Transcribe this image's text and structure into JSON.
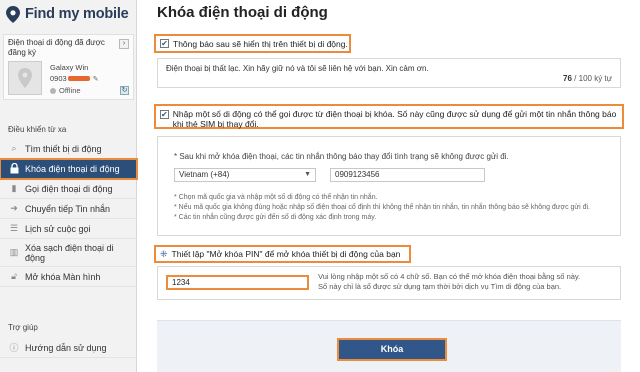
{
  "brand": {
    "name": "Find my mobile"
  },
  "device_box": {
    "title": "Điện thoại di động đã được đăng ký",
    "device_name": "Galaxy Win",
    "number_prefix": "0903",
    "status": "Offline"
  },
  "sidebar": {
    "section_remote": "Điều khiển từ xa",
    "items": [
      {
        "label": "Tìm thiết bị di động",
        "icon": "search-icon"
      },
      {
        "label": "Khóa điện thoại di động",
        "icon": "lock-icon",
        "active": true
      },
      {
        "label": "Gọi điện thoại di động",
        "icon": "phone-icon"
      },
      {
        "label": "Chuyển tiếp Tin nhắn",
        "icon": "forward-icon"
      },
      {
        "label": "Lịch sử cuộc gọi",
        "icon": "list-icon"
      },
      {
        "label": "Xóa sạch điện thoại di động",
        "icon": "trash-icon"
      },
      {
        "label": "Mở khóa Màn hình",
        "icon": "unlock-icon"
      }
    ],
    "section_help": "Trợ giúp",
    "help_item": {
      "label": "Hướng dẫn sử dụng",
      "icon": "info-icon"
    }
  },
  "main": {
    "title": "Khóa điện thoại di động",
    "notify": {
      "label": "Thông báo sau sẽ hiển thị trên thiết bị di động.",
      "message": "Điện thoại bị thất lạc. Xin hãy giữ nó và tôi sẽ liên hệ với bạn. Xin cảm ơn.",
      "count": "76",
      "count_suffix": "/ 100 ký tự"
    },
    "contact": {
      "label": "Nhập một số di động có thể gọi được từ điện thoại bị khóa. Số này cũng được sử dụng để gửi một tin nhắn thông báo khi thẻ SIM bị thay đổi.",
      "note": "* Sau khi mở khóa điện thoại, các tin nhắn thông báo thay đổi tình trạng sẽ không được gửi đi.",
      "country": "Vietnam (+84)",
      "phone": "0909123456",
      "notes": [
        "* Chọn mã quốc gia và nhập một số di động có thể nhận tin nhắn.",
        "* Nếu mã quốc gia không đúng hoặc nhập số điện thoại cố định thì không thể nhận tin nhắn, tin nhắn thông báo sẽ không được gửi đi.",
        "* Các tin nhắn cũng được gửi đến số di động xác định trong máy."
      ]
    },
    "pin": {
      "label": "Thiết lập \"Mở khóa PIN\" để mở khóa thiết bị di động của bạn",
      "value": "1234",
      "note1": "Vui lòng nhập một số có 4 chữ số. Bạn có thể mở khóa điện thoại bằng số này.",
      "note2": "Số này chỉ là số được sử dụng tạm thời bởi dịch vụ Tìm di động của bạn."
    },
    "submit_label": "Khóa"
  },
  "colors": {
    "accent": "#ec8c3a",
    "primary": "#30568a",
    "active_nav": "#2c4f7a"
  }
}
